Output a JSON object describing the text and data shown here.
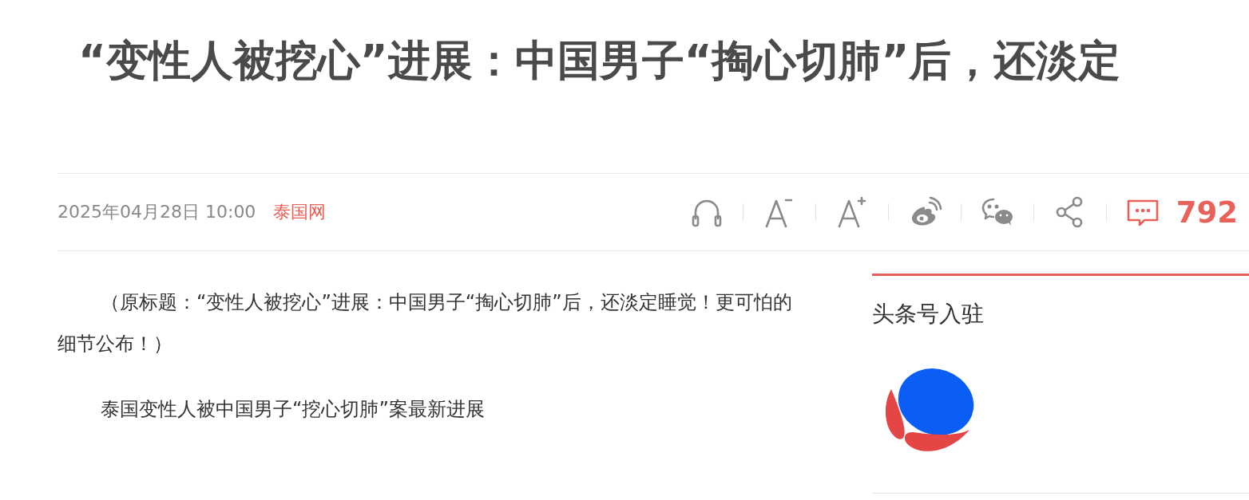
{
  "headline": "“变性人被挖心”进展：中国男子“掏心切肺”后，还淡定",
  "meta": {
    "date": "2025年04月28日 10:00",
    "source": "泰国网",
    "comment_count": "792"
  },
  "paragraphs": [
    "（原标题：“变性人被挖心”进展：中国男子“掏心切肺”后，还淡定睡觉！更可怕的细节公布！）",
    "泰国变性人被中国男子“挖心切肺”案最新进展"
  ],
  "sidebar": {
    "heading": "头条号入驻"
  }
}
